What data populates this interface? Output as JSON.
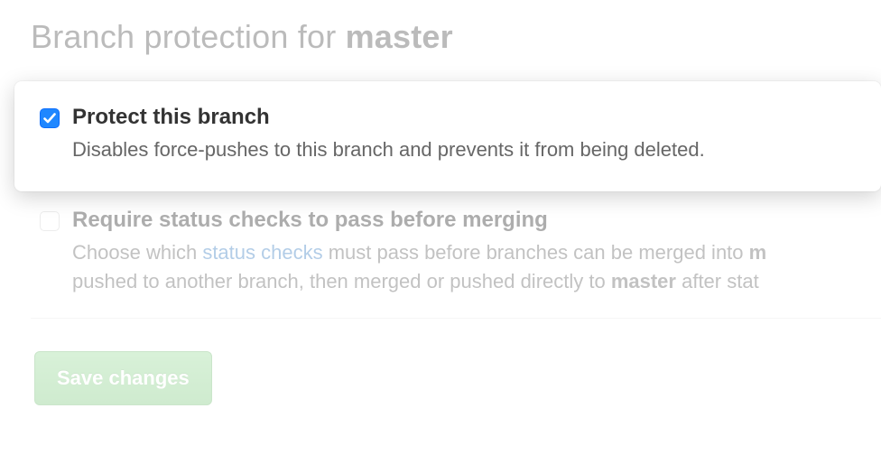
{
  "title_prefix": "Branch protection for ",
  "branch_name": "master",
  "protect": {
    "checked": true,
    "title": "Protect this branch",
    "desc": "Disables force-pushes to this branch and prevents it from being deleted."
  },
  "require_checks": {
    "checked": false,
    "title": "Require status checks to pass before merging",
    "desc_pre": "Choose which ",
    "link_text": "status checks",
    "desc_mid1": " must pass before branches can be merged into ",
    "bold1": "m",
    "desc_mid2": "pushed to another branch, then merged or pushed directly to ",
    "bold2": "master",
    "desc_post": " after stat"
  },
  "save_label": "Save changes"
}
